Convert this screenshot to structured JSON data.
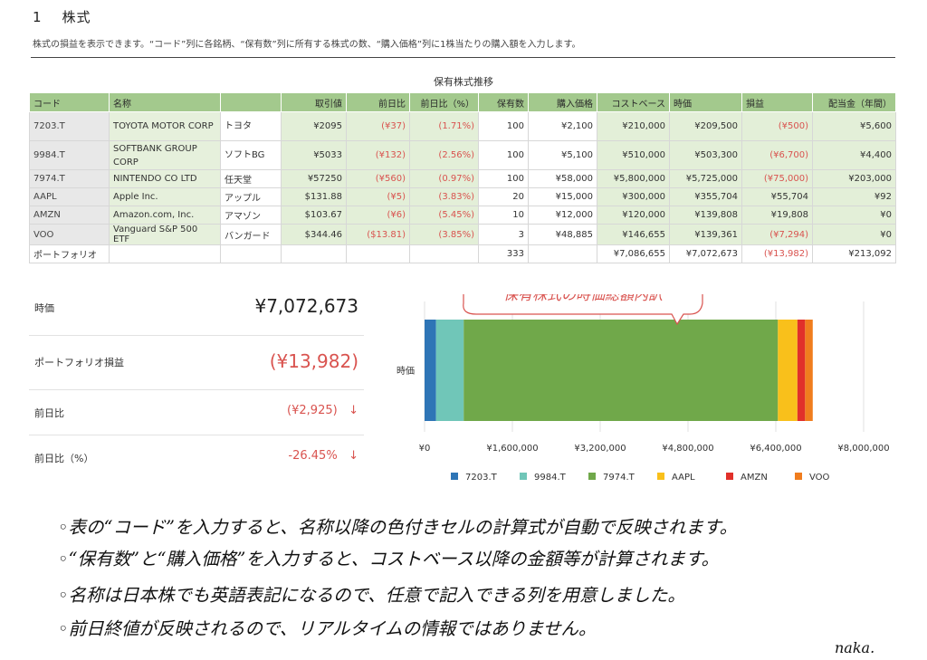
{
  "header": {
    "section_number": "1",
    "section_title": "株式",
    "description": "株式の損益を表示できます。“コード”列に各銘柄、“保有数”列に所有する株式の数、“購入価格”列に1株当たりの購入額を入力します。"
  },
  "table": {
    "title": "保有株式推移",
    "columns": [
      "コード",
      "名称",
      "",
      "取引値",
      "前日比",
      "前日比（%）",
      "保有数",
      "購入価格",
      "コストベース",
      "時価",
      "損益",
      "配当金（年間）"
    ],
    "rows": [
      {
        "code": "7203.T",
        "name": "TOYOTA MOTOR CORP",
        "alias": "トヨタ",
        "price": "¥2095",
        "change": "(¥37)",
        "change_pct": "(1.71%)",
        "shares": "100",
        "purchase": "¥2,100",
        "cost": "¥210,000",
        "value": "¥209,500",
        "pl": "(¥500)",
        "dividend": "¥5,600"
      },
      {
        "code": "9984.T",
        "name": "SOFTBANK GROUP CORP",
        "alias": "ソフトBG",
        "price": "¥5033",
        "change": "(¥132)",
        "change_pct": "(2.56%)",
        "shares": "100",
        "purchase": "¥5,100",
        "cost": "¥510,000",
        "value": "¥503,300",
        "pl": "(¥6,700)",
        "dividend": "¥4,400"
      },
      {
        "code": "7974.T",
        "name": "NINTENDO CO LTD",
        "alias": "任天堂",
        "price": "¥57250",
        "change": "(¥560)",
        "change_pct": "(0.97%)",
        "shares": "100",
        "purchase": "¥58,000",
        "cost": "¥5,800,000",
        "value": "¥5,725,000",
        "pl": "(¥75,000)",
        "dividend": "¥203,000"
      },
      {
        "code": "AAPL",
        "name": "Apple Inc.",
        "alias": "アップル",
        "price": "$131.88",
        "change": "(¥5)",
        "change_pct": "(3.83%)",
        "shares": "20",
        "purchase": "¥15,000",
        "cost": "¥300,000",
        "value": "¥355,704",
        "pl": "¥55,704",
        "dividend": "¥92"
      },
      {
        "code": "AMZN",
        "name": "Amazon.com, Inc.",
        "alias": "アマゾン",
        "price": "$103.67",
        "change": "(¥6)",
        "change_pct": "(5.45%)",
        "shares": "10",
        "purchase": "¥12,000",
        "cost": "¥120,000",
        "value": "¥139,808",
        "pl": "¥19,808",
        "dividend": "¥0"
      },
      {
        "code": "VOO",
        "name": "Vanguard S&P 500 ETF",
        "alias": "バンガード",
        "price": "$344.46",
        "change": "($13.81)",
        "change_pct": "(3.85%)",
        "shares": "3",
        "purchase": "¥48,885",
        "cost": "¥146,655",
        "value": "¥139,361",
        "pl": "(¥7,294)",
        "dividend": "¥0"
      }
    ],
    "total": {
      "label": "ポートフォリオ",
      "shares": "333",
      "cost": "¥7,086,655",
      "value": "¥7,072,673",
      "pl": "(¥13,982)",
      "dividend": "¥213,092"
    }
  },
  "summary": {
    "market_value_label": "時価",
    "market_value": "¥7,072,673",
    "portfolio_pl_label": "ポートフォリオ損益",
    "portfolio_pl": "(¥13,982)",
    "day_change_label": "前日比",
    "day_change": "(¥2,925)",
    "day_change_arrow": "↓",
    "day_change_pct_label": "前日比（%）",
    "day_change_pct": "-26.45%",
    "day_change_pct_arrow": "↓"
  },
  "chart_data": {
    "type": "bar",
    "orientation": "horizontal",
    "stacked": true,
    "callout": "保有株式の時価総額内訳",
    "categories": [
      "時価"
    ],
    "series": [
      {
        "name": "7203.T",
        "values": [
          209500
        ],
        "color": "#2e75b6"
      },
      {
        "name": "9984.T",
        "values": [
          503300
        ],
        "color": "#70c6b8"
      },
      {
        "name": "7974.T",
        "values": [
          5725000
        ],
        "color": "#70a84a"
      },
      {
        "name": "AAPL",
        "values": [
          355704
        ],
        "color": "#f9c01b"
      },
      {
        "name": "AMZN",
        "values": [
          139808
        ],
        "color": "#e1302a"
      },
      {
        "name": "VOO",
        "values": [
          139361
        ],
        "color": "#f07d1e"
      }
    ],
    "xlim": [
      0,
      8000000
    ],
    "xticks": [
      "¥0",
      "¥1,600,000",
      "¥3,200,000",
      "¥4,800,000",
      "¥6,400,000",
      "¥8,000,000"
    ],
    "xtick_values": [
      0,
      1600000,
      3200000,
      4800000,
      6400000,
      8000000
    ],
    "grid": true,
    "legend_position": "bottom"
  },
  "notes": [
    "◦表の“コード”を入力すると、名称以降の色付きセルの計算式が自動で反映されます。",
    "◦“保有数”と“購入価格”を入力すると、コストベース以降の金額等が計算されます。",
    "◦名称は日本株でも英語表記になるので、任意で記入できる列を用意しました。",
    "◦前日終値が反映されるので、リアルタイムの情報ではありません。"
  ],
  "signature": "naka."
}
